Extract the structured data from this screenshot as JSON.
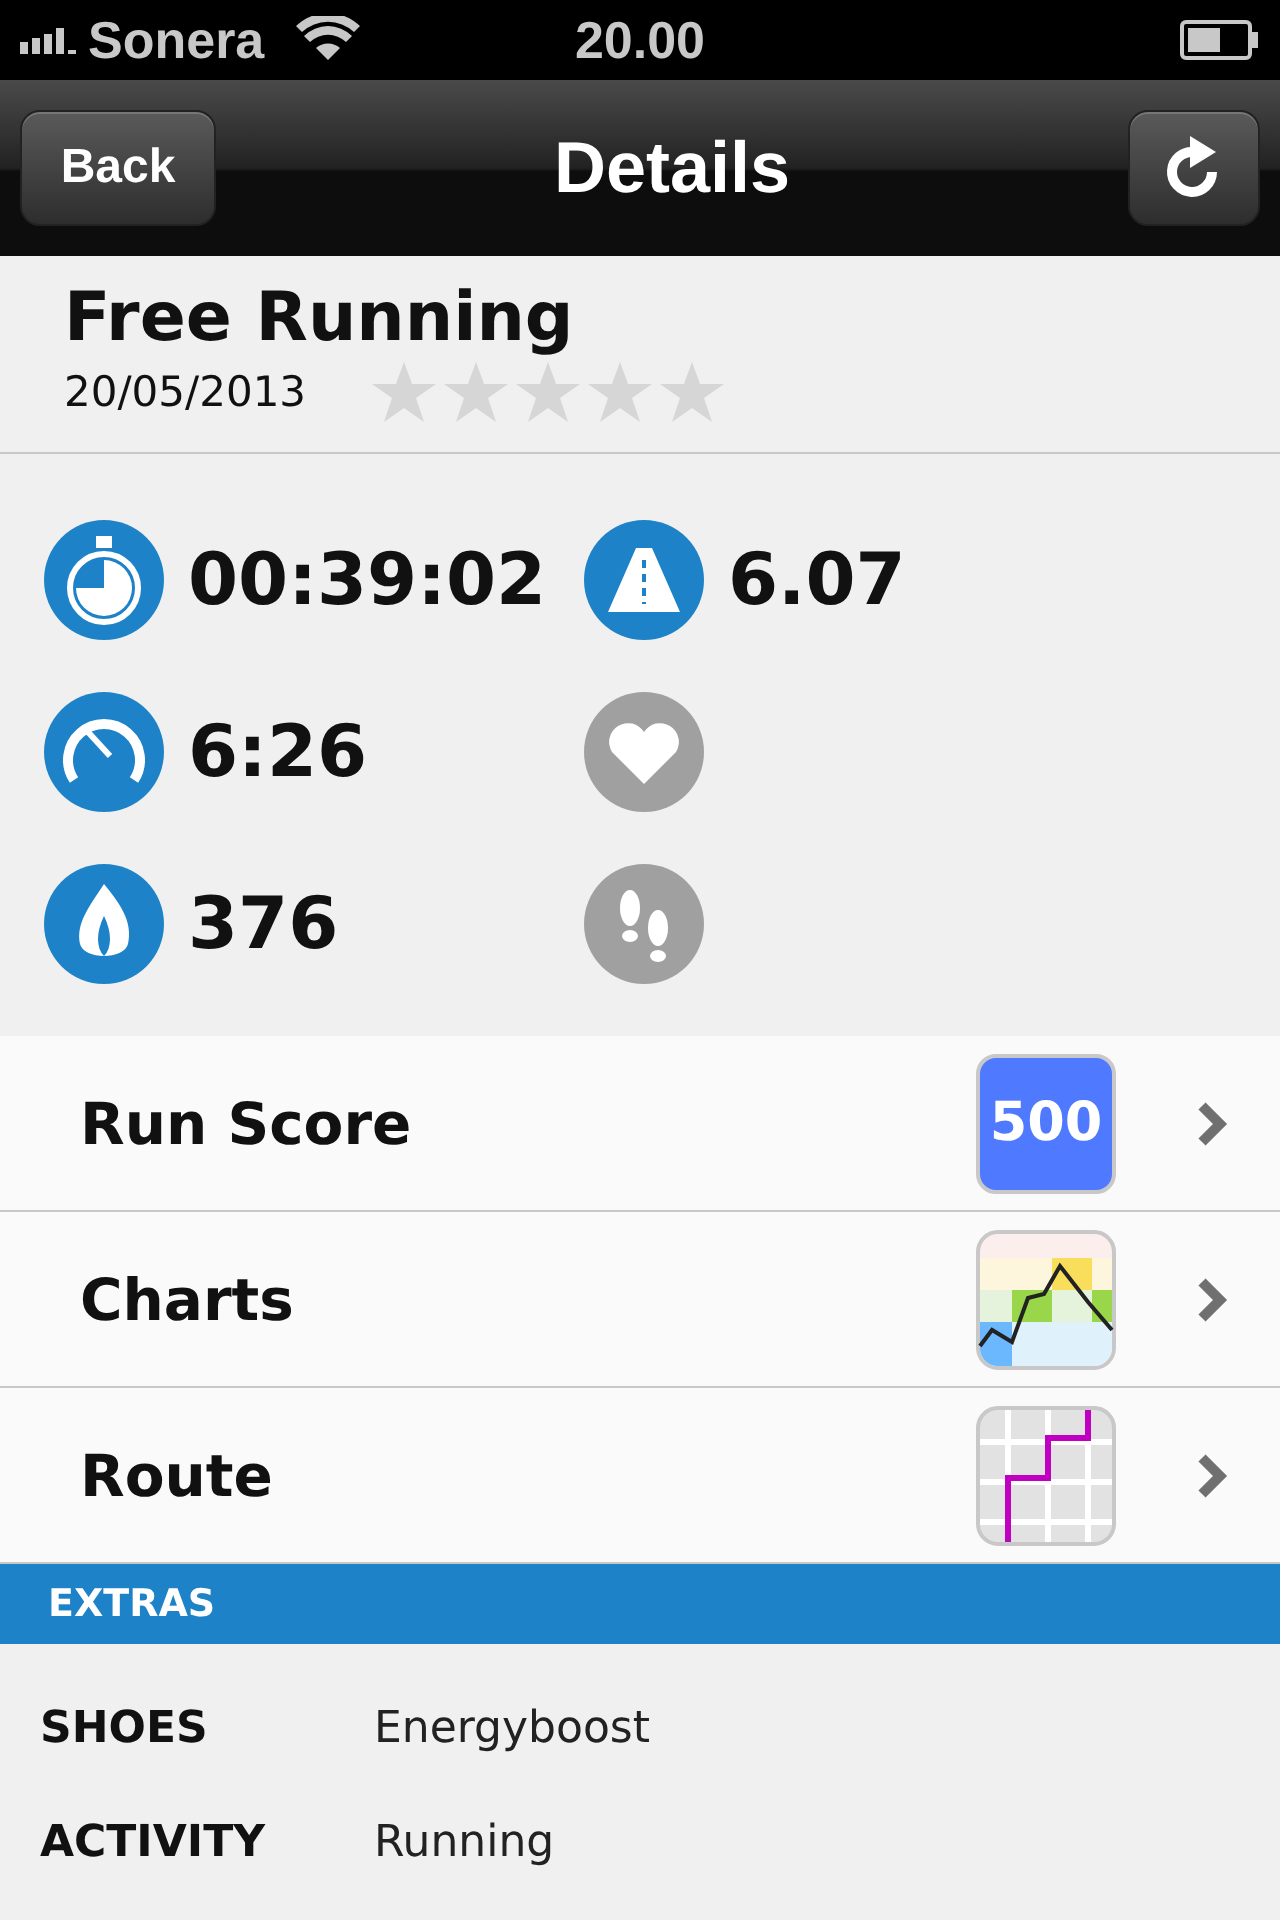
{
  "status_bar": {
    "carrier": "Sonera",
    "time": "20.00"
  },
  "nav": {
    "back": "Back",
    "title": "Details"
  },
  "workout": {
    "name": "Free Running",
    "date": "20/05/2013",
    "stars": 0
  },
  "stats": [
    {
      "kind": "duration",
      "value": "00:39:02",
      "active": true
    },
    {
      "kind": "distance",
      "value": "6.07",
      "active": true
    },
    {
      "kind": "pace",
      "value": "6:26",
      "active": true
    },
    {
      "kind": "heart",
      "active": false
    },
    {
      "kind": "calories",
      "value": "376",
      "active": true
    },
    {
      "kind": "steps",
      "active": false
    }
  ],
  "rows": [
    {
      "kind": "score",
      "label": "Run Score",
      "badge": "500"
    },
    {
      "kind": "charts",
      "label": "Charts"
    },
    {
      "kind": "route",
      "label": "Route"
    }
  ],
  "extras": {
    "title": "EXTRAS",
    "items": [
      {
        "label": "SHOES",
        "value": "Energyboost"
      },
      {
        "label": "ACTIVITY",
        "value": "Running"
      }
    ]
  }
}
